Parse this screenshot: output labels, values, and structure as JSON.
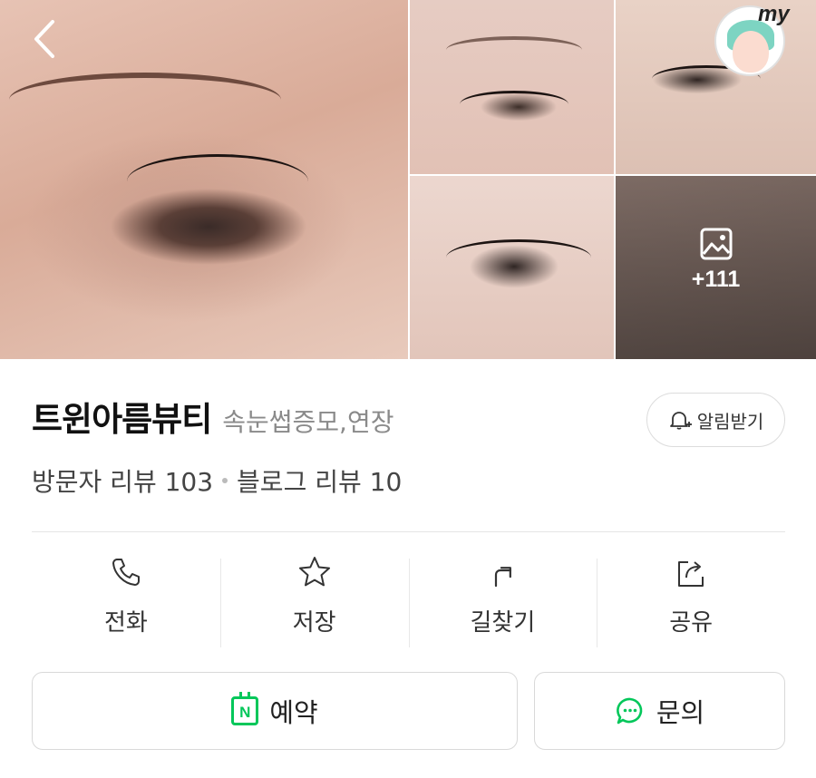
{
  "gallery": {
    "more_count": "+111"
  },
  "header": {
    "my_label": "my"
  },
  "place": {
    "name": "트윈아름뷰티",
    "category": "속눈썹증모,연장",
    "alarm_label": "알림받기",
    "visitor_reviews": "방문자 리뷰 103",
    "blog_reviews": "블로그 리뷰 10"
  },
  "actions": {
    "call": "전화",
    "save": "저장",
    "directions": "길찾기",
    "share": "공유"
  },
  "cta": {
    "reserve": "예약",
    "inquiry": "문의",
    "naver_badge": "N"
  },
  "colors": {
    "naver_green": "#03c75a",
    "text_primary": "#111111",
    "text_secondary": "#8a8a8a",
    "border": "#dcdcdc"
  }
}
